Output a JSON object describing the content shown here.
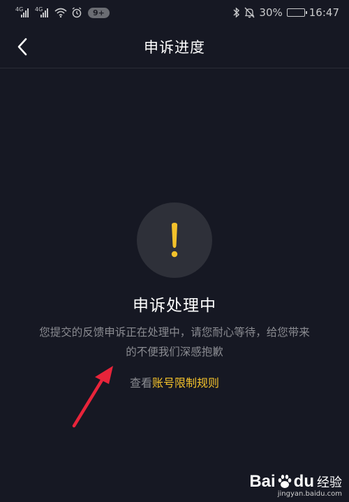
{
  "status_bar": {
    "network_1": "4G",
    "network_2": "4G",
    "notification_count": "9+",
    "battery_percent": "30%",
    "battery_level": 0.3,
    "time": "16:47",
    "icons": [
      "signal-icon",
      "signal-icon",
      "wifi-icon",
      "alarm-icon",
      "bluetooth-icon",
      "mute-icon",
      "battery-icon"
    ]
  },
  "nav": {
    "back_icon": "chevron-left-icon",
    "title": "申诉进度"
  },
  "status": {
    "icon": "exclamation-icon",
    "icon_color": "#f4c22b",
    "title": "申诉处理中",
    "description": "您提交的反馈申诉正在处理中，请您耐心等待，给您带来的不便我们深感抱歉",
    "rule_prefix": "查看",
    "rule_link": "账号限制规则"
  },
  "annotation": {
    "arrow_color": "#e8243a"
  },
  "watermark": {
    "brand_left": "Bai",
    "brand_right": "du",
    "brand_suffix": "经验",
    "url": "jingyan.baidu.com"
  },
  "colors": {
    "background": "#161823",
    "accent": "#f4c22b",
    "circle": "#2e3039",
    "secondary_text": "#8a8b91"
  }
}
